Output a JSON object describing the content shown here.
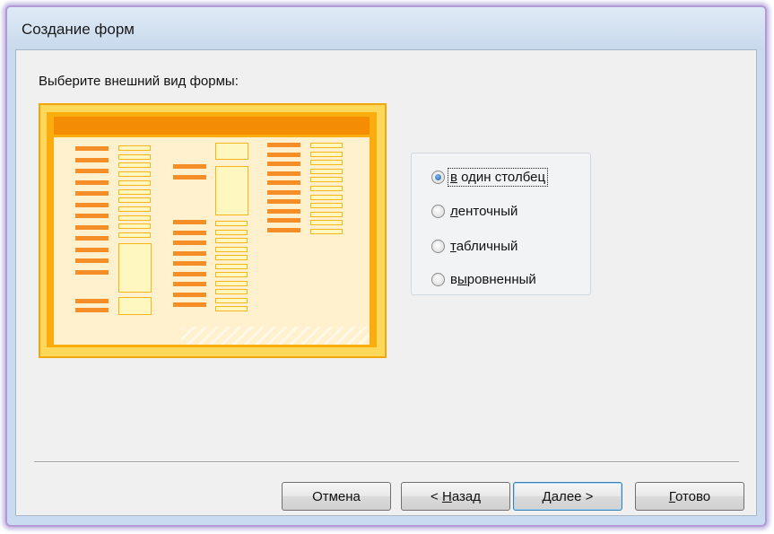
{
  "window": {
    "title": "Создание форм"
  },
  "main": {
    "prompt": "Выберите внешний вид формы:",
    "layout_options": [
      {
        "label": "в один столбец",
        "selected": true,
        "mnemonic": "в"
      },
      {
        "label": "ленточный",
        "selected": false,
        "mnemonic": "л"
      },
      {
        "label": "табличный",
        "selected": false,
        "mnemonic": "т"
      },
      {
        "label": "выровненный",
        "selected": false,
        "mnemonic": "ы"
      }
    ]
  },
  "buttons": {
    "cancel": {
      "label": "Отмена"
    },
    "back": {
      "prefix": "< ",
      "mnemonic": "Н",
      "rest": "азад"
    },
    "next": {
      "mnemonic": "Д",
      "rest": "алее >"
    },
    "finish": {
      "mnemonic": "Г",
      "rest": "отово"
    }
  },
  "colors": {
    "preview_frame": "#fbad0f",
    "preview_header": "#f48c04",
    "preview_body": "#fff1cd",
    "label_bar": "#f58e27",
    "radio_selected": "#1c5fa8"
  }
}
